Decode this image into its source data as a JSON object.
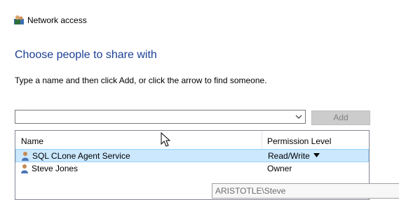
{
  "window": {
    "title": "Network access",
    "app_icon": "network-users-icon"
  },
  "dialog": {
    "heading": "Choose people to share with",
    "instruction": "Type a name and then click Add, or click the arrow to find someone.",
    "combo": {
      "value": "",
      "dropdown_icon": "chevron-down-icon"
    },
    "add_label": "Add"
  },
  "list": {
    "columns": {
      "name": "Name",
      "permission": "Permission Level"
    },
    "rows": [
      {
        "name": "SQL CLone Agent Service",
        "permission": "Read/Write",
        "selected": true,
        "icon": "user-icon"
      },
      {
        "name": "Steve Jones",
        "permission": "Owner",
        "selected": false,
        "icon": "user-icon"
      }
    ]
  },
  "tooltip": {
    "text": "ARISTOTLE\\Steve"
  },
  "colors": {
    "heading": "#1c3f94",
    "selection": "#cce8ff",
    "selection_border": "#99d1ff"
  }
}
